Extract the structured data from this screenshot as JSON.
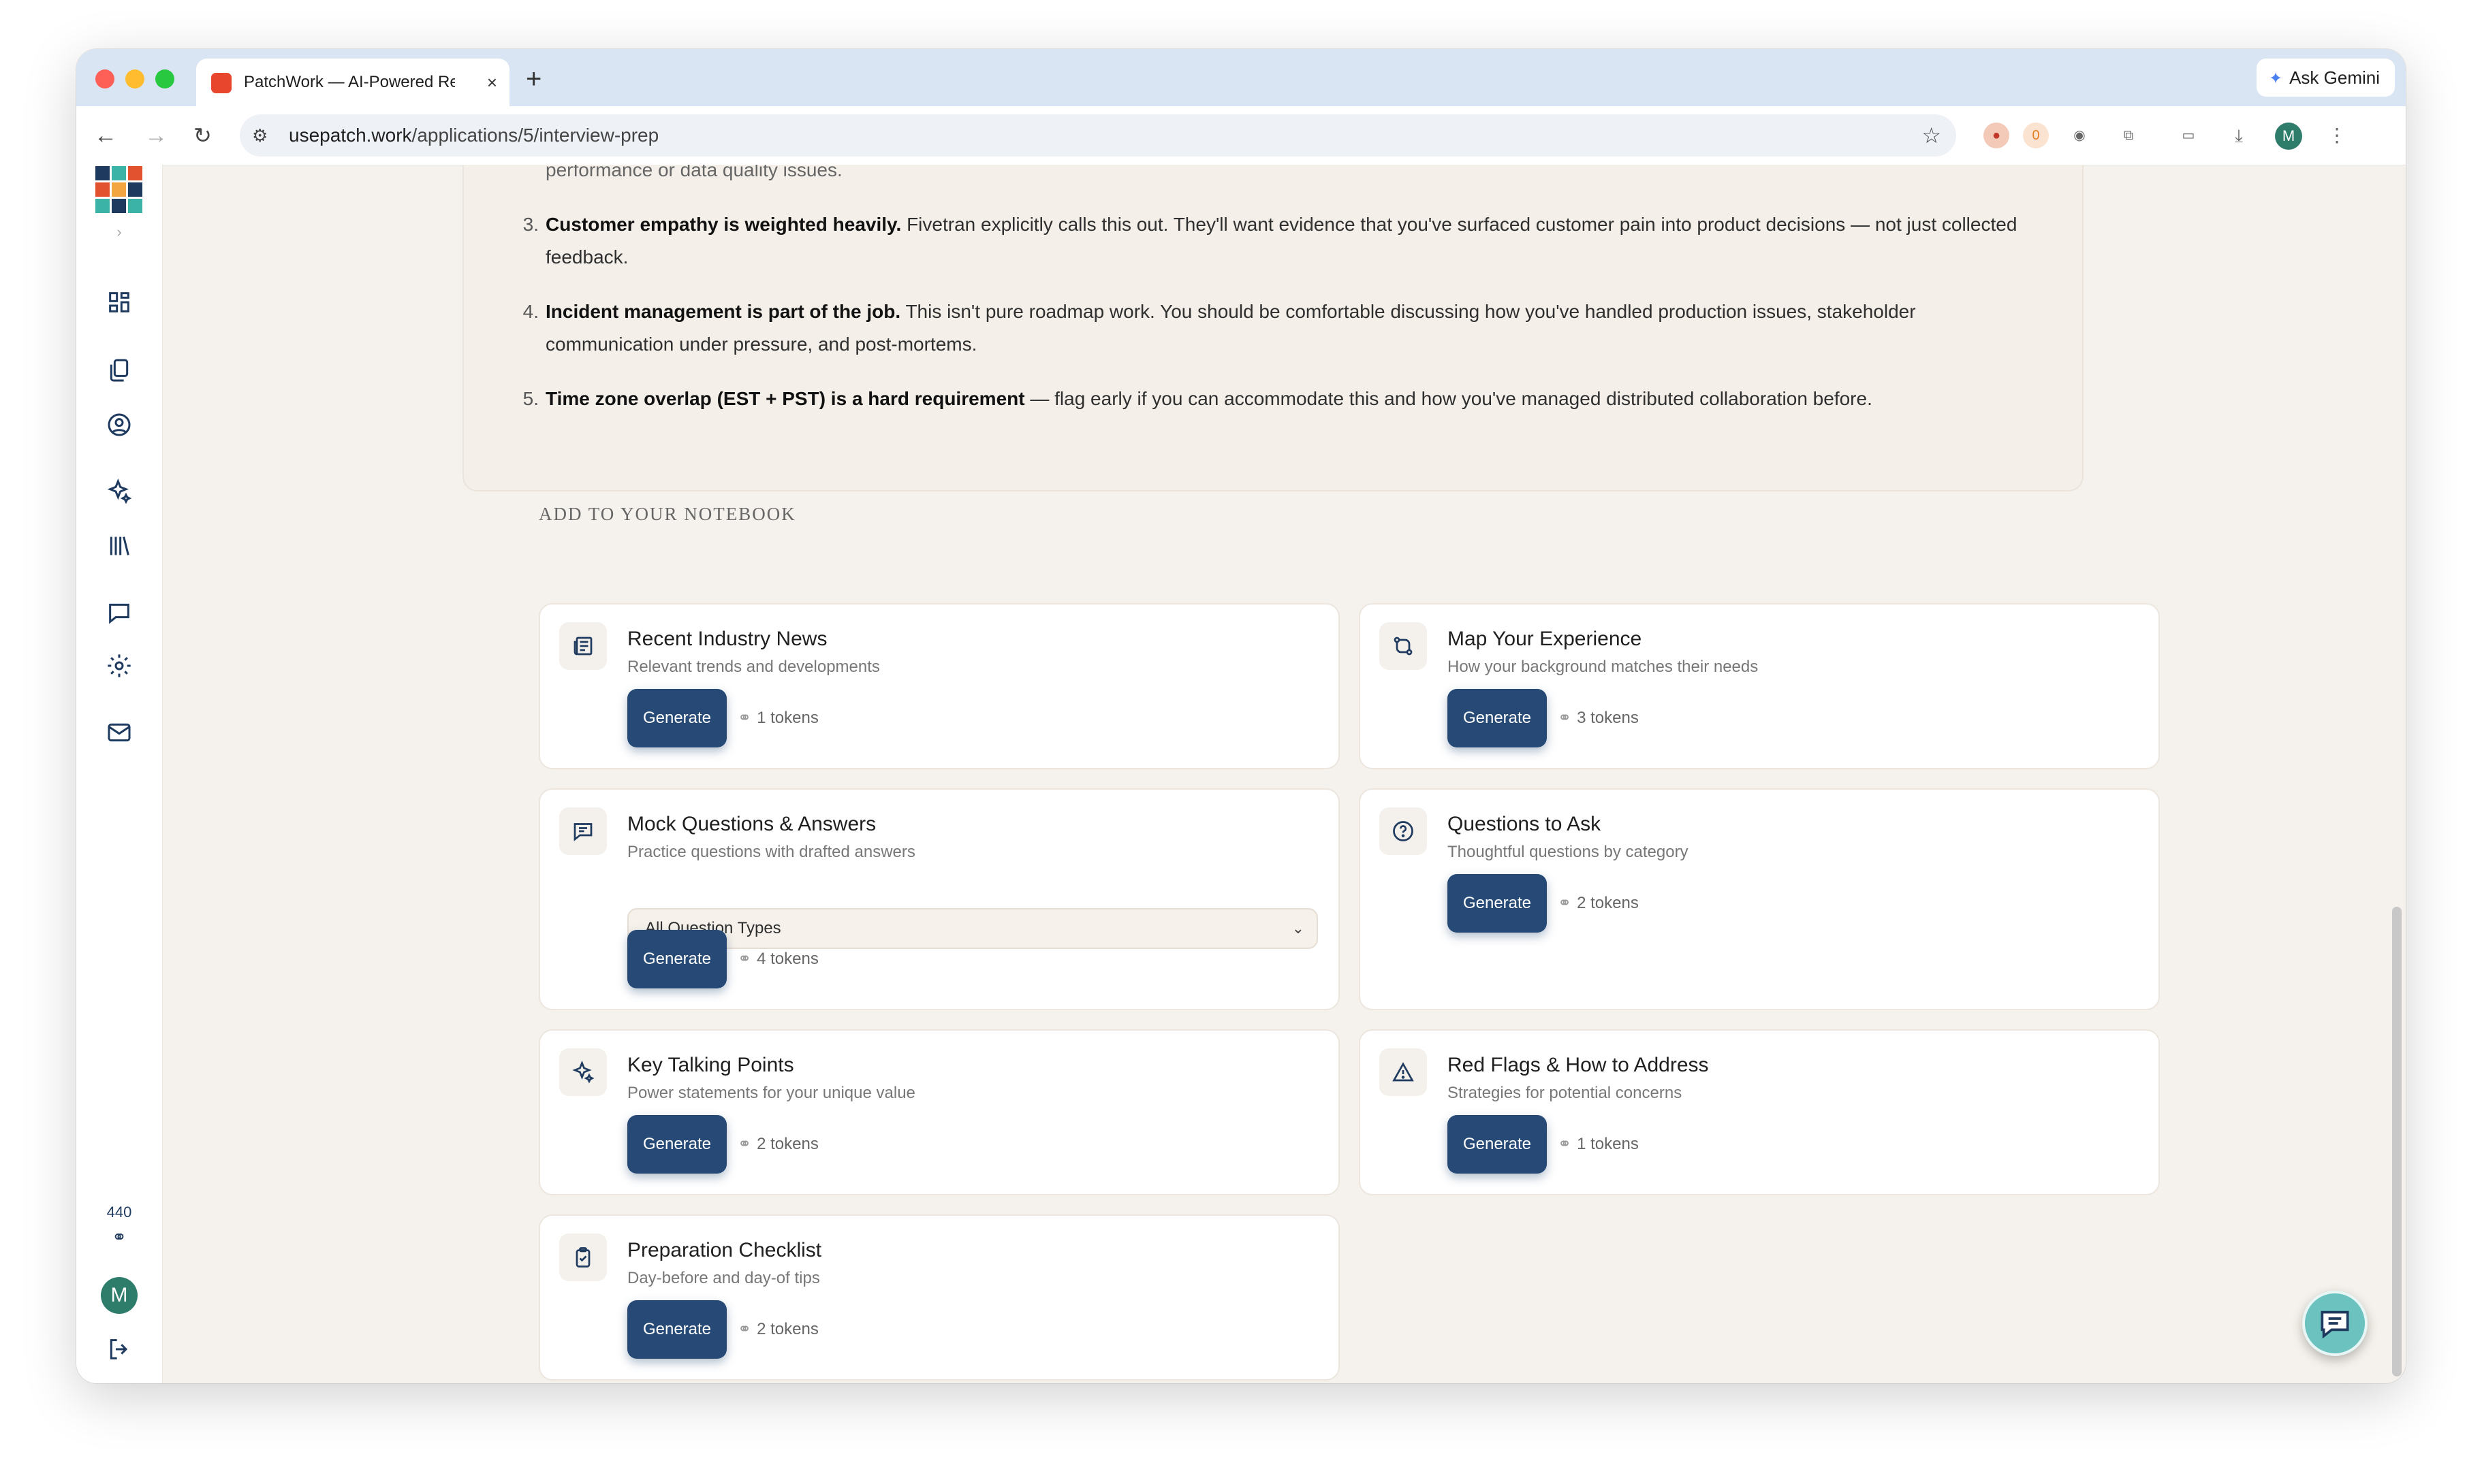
{
  "browser": {
    "tab_title": "PatchWork — AI-Powered Re",
    "tab_close": "×",
    "new_tab": "+",
    "gemini_label": "Ask Gemini",
    "url_host": "usepatch.work",
    "url_path": "/applications/5/interview-prep",
    "profile_initial": "M",
    "extension_badge": "0"
  },
  "sidebar": {
    "tokens": "440",
    "avatar_initial": "M",
    "logo_colors": [
      "#1f3a5f",
      "#e2522e",
      "#3bb3a6",
      "#f2a541"
    ]
  },
  "insights": {
    "partial_text": "performance or data quality issues.",
    "items": [
      {
        "num": "3.",
        "bold": "Customer empathy is weighted heavily.",
        "text": " Fivetran explicitly calls this out. They'll want evidence that you've surfaced customer pain into product decisions — not just collected",
        "text2": "feedback."
      },
      {
        "num": "4.",
        "bold": "Incident management is part of the job.",
        "text": " This isn't pure roadmap work. You should be comfortable discussing how you've handled production issues, stakeholder",
        "text2": "communication under pressure, and post-mortems."
      },
      {
        "num": "5.",
        "bold": "Time zone overlap (EST + PST) is a hard requirement",
        "text": " — flag early if you can accommodate this and how you've managed distributed collaboration before.",
        "text2": ""
      }
    ]
  },
  "notebook": {
    "section_title": "ADD TO YOUR NOTEBOOK",
    "generate_label": "Generate",
    "cards": [
      {
        "title": "Recent Industry News",
        "subtitle": "Relevant trends and developments",
        "tokens": "1 tokens",
        "icon": "newspaper-icon"
      },
      {
        "title": "Map Your Experience",
        "subtitle": "How your background matches their needs",
        "tokens": "3 tokens",
        "icon": "route-icon"
      },
      {
        "title": "Mock Questions & Answers",
        "subtitle": "Practice questions with drafted answers",
        "tokens": "4 tokens",
        "icon": "message-icon",
        "select_value": "All Question Types"
      },
      {
        "title": "Questions to Ask",
        "subtitle": "Thoughtful questions by category",
        "tokens": "2 tokens",
        "icon": "question-icon"
      },
      {
        "title": "Key Talking Points",
        "subtitle": "Power statements for your unique value",
        "tokens": "2 tokens",
        "icon": "sparkles-icon"
      },
      {
        "title": "Red Flags & How to Address",
        "subtitle": "Strategies for potential concerns",
        "tokens": "1 tokens",
        "icon": "warning-icon"
      },
      {
        "title": "Preparation Checklist",
        "subtitle": "Day-before and day-of tips",
        "tokens": "2 tokens",
        "icon": "clipboard-icon"
      }
    ]
  }
}
